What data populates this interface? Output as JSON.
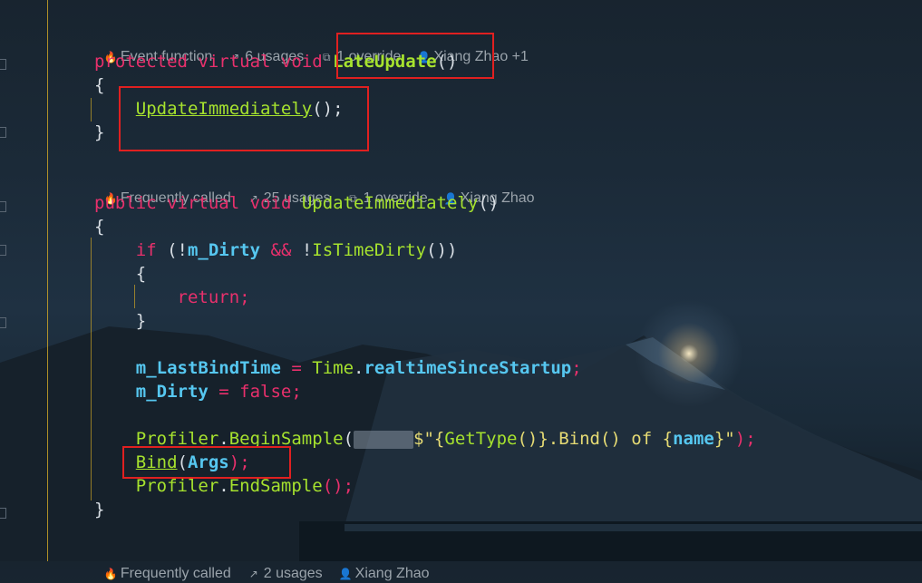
{
  "hints": [
    {
      "icon": "flame-icon",
      "glyph": "🔥",
      "kind": "Event function",
      "usages": "6 usages",
      "overrides": "1 override",
      "author": "Xiang Zhao +1"
    },
    {
      "icon": "flame-icon",
      "glyph": "🔥",
      "kind": "Frequently called",
      "usages": "25 usages",
      "overrides": "1 override",
      "author": "Xiang Zhao"
    },
    {
      "icon": "flame-icon",
      "glyph": "🔥",
      "kind": "Frequently called",
      "usages": "2 usages",
      "author": "Xiang Zhao"
    }
  ],
  "code": {
    "l1": {
      "a": "protected",
      "b": "virtual",
      "c": "void",
      "fn": "LateUpdate",
      "tail": "()"
    },
    "brace_open": "{",
    "brace_close": "}",
    "l3": {
      "fn": "UpdateImmediately",
      "tail": "();"
    },
    "l5": {
      "a": "public",
      "b": "virtual",
      "c": "void",
      "fn": "UpdateImmediately",
      "tail": "()"
    },
    "l7": {
      "kw": "if",
      "p1": " (!",
      "f1": "m_Dirty",
      "op": " && ",
      "not": "!",
      "fn": "IsTimeDirty",
      "tail": "())"
    },
    "ret": "return;",
    "l12": {
      "f": "m_LastBindTime",
      "eq": " = ",
      "cls": "Time",
      "dot": ".",
      "prop": "realtimeSinceStartup",
      "semi": ";"
    },
    "l13": {
      "f": "m_Dirty",
      "eq": " = ",
      "kw": "false",
      "semi": ";"
    },
    "l15": {
      "cls": "Profiler",
      "dot": ".",
      "fn": "BeginSample",
      "open": "(",
      "str1": "$\"",
      "s2": "{",
      "fn2": "GetType",
      "s3": "()}",
      "s4": ".Bind() of ",
      "s5": "{",
      "fld": "name",
      "s6": "}",
      "s7": "\"",
      "close": ");"
    },
    "l16": {
      "fn": "Bind",
      "open": "(",
      "arg": "Args",
      "close": ");"
    },
    "l17": {
      "cls": "Profiler",
      "dot": ".",
      "fn": "EndSample",
      "tail": "();"
    }
  },
  "colors": {
    "keyword": "#e8306c",
    "function": "#a6e22e",
    "field": "#56c7f0",
    "highlight_box": "#e02020"
  }
}
